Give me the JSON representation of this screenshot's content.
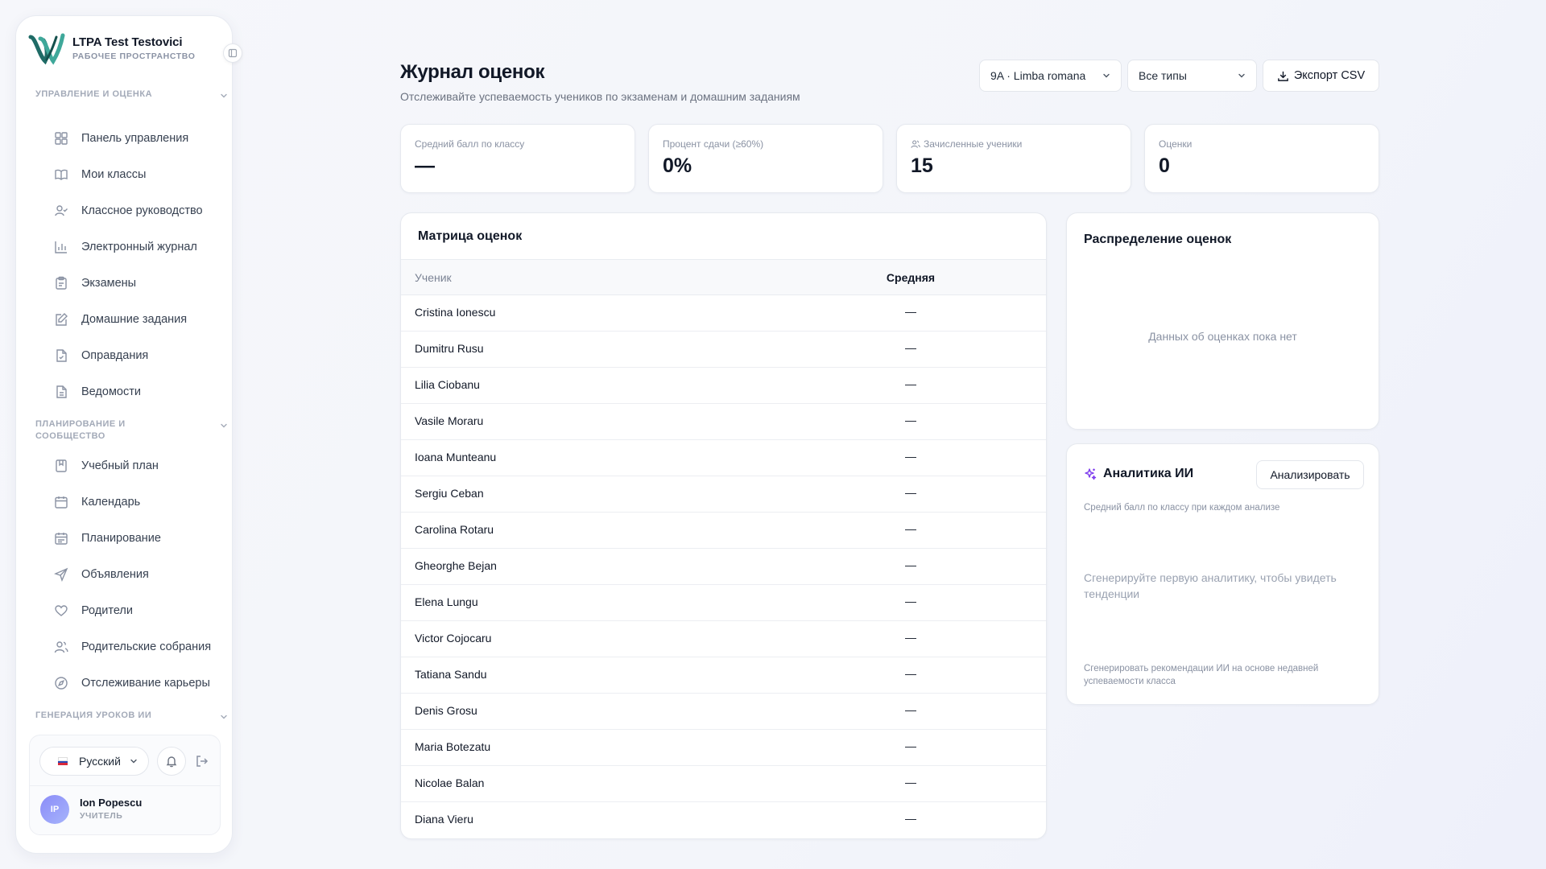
{
  "brand": {
    "name": "LTPA Test Testovici",
    "subtitle": "РАБОЧЕЕ ПРОСТРАНСТВО"
  },
  "sidebar": {
    "sections": [
      {
        "label": "УПРАВЛЕНИЕ И ОЦЕНКА"
      },
      {
        "label": "ПЛАНИРОВАНИЕ И СООБЩЕСТВО"
      },
      {
        "label": "ГЕНЕРАЦИЯ УРОКОВ ИИ"
      }
    ],
    "items": [
      {
        "label": "Панель управления",
        "icon": "dashboard-icon"
      },
      {
        "label": "Мои классы",
        "icon": "book-open-icon"
      },
      {
        "label": "Классное руководство",
        "icon": "user-check-icon"
      },
      {
        "label": "Электронный журнал",
        "icon": "bar-chart-icon"
      },
      {
        "label": "Экзамены",
        "icon": "clipboard-icon"
      },
      {
        "label": "Домашние задания",
        "icon": "edit-icon"
      },
      {
        "label": "Оправдания",
        "icon": "file-check-icon"
      },
      {
        "label": "Ведомости",
        "icon": "file-text-icon"
      },
      {
        "label": "Учебный план",
        "icon": "notebook-icon"
      },
      {
        "label": "Календарь",
        "icon": "calendar-icon"
      },
      {
        "label": "Планирование",
        "icon": "calendar-list-icon"
      },
      {
        "label": "Объявления",
        "icon": "send-icon"
      },
      {
        "label": "Родители",
        "icon": "heart-icon"
      },
      {
        "label": "Родительские собрания",
        "icon": "users-icon"
      },
      {
        "label": "Отслеживание карьеры",
        "icon": "compass-icon"
      }
    ],
    "language": "Русский",
    "user": {
      "initials": "IP",
      "name": "Ion Popescu",
      "role": "УЧИТЕЛЬ"
    }
  },
  "header": {
    "title": "Журнал оценок",
    "subtitle": "Отслеживайте успеваемость учеников по экзаменам и домашним заданиям",
    "class_select": "9A · Limba romana",
    "type_select": "Все типы",
    "export_label": "Экспорт CSV"
  },
  "stats": [
    {
      "label": "Средний балл по классу",
      "value": "—"
    },
    {
      "label": "Процент сдачи (≥60%)",
      "value": "0%"
    },
    {
      "label": "Зачисленные ученики",
      "value": "15"
    },
    {
      "label": "Оценки",
      "value": "0"
    }
  ],
  "matrix": {
    "title": "Матрица оценок",
    "columns": [
      "Ученик",
      "Средняя"
    ],
    "rows": [
      {
        "name": "Cristina Ionescu",
        "avg": "—"
      },
      {
        "name": "Dumitru Rusu",
        "avg": "—"
      },
      {
        "name": "Lilia Ciobanu",
        "avg": "—"
      },
      {
        "name": "Vasile Moraru",
        "avg": "—"
      },
      {
        "name": "Ioana Munteanu",
        "avg": "—"
      },
      {
        "name": "Sergiu Ceban",
        "avg": "—"
      },
      {
        "name": "Carolina Rotaru",
        "avg": "—"
      },
      {
        "name": "Gheorghe Bejan",
        "avg": "—"
      },
      {
        "name": "Elena Lungu",
        "avg": "—"
      },
      {
        "name": "Victor Cojocaru",
        "avg": "—"
      },
      {
        "name": "Tatiana Sandu",
        "avg": "—"
      },
      {
        "name": "Denis Grosu",
        "avg": "—"
      },
      {
        "name": "Maria Botezatu",
        "avg": "—"
      },
      {
        "name": "Nicolae Balan",
        "avg": "—"
      },
      {
        "name": "Diana Vieru",
        "avg": "—"
      }
    ]
  },
  "distribution": {
    "title": "Распределение оценок",
    "empty": "Данных об оценках пока нет"
  },
  "ai": {
    "title": "Аналитика ИИ",
    "button": "Анализировать",
    "subtitle": "Средний балл по классу при каждом анализе",
    "empty": "Сгенерируйте первую аналитику, чтобы увидеть тенденции",
    "footer": "Сгенерировать рекомендации ИИ на основе недавней успеваемости класса"
  },
  "colors": {
    "accent": "#7c3aed",
    "logo": "#1f6b66",
    "text": "#111827",
    "muted": "#8a92a3"
  }
}
